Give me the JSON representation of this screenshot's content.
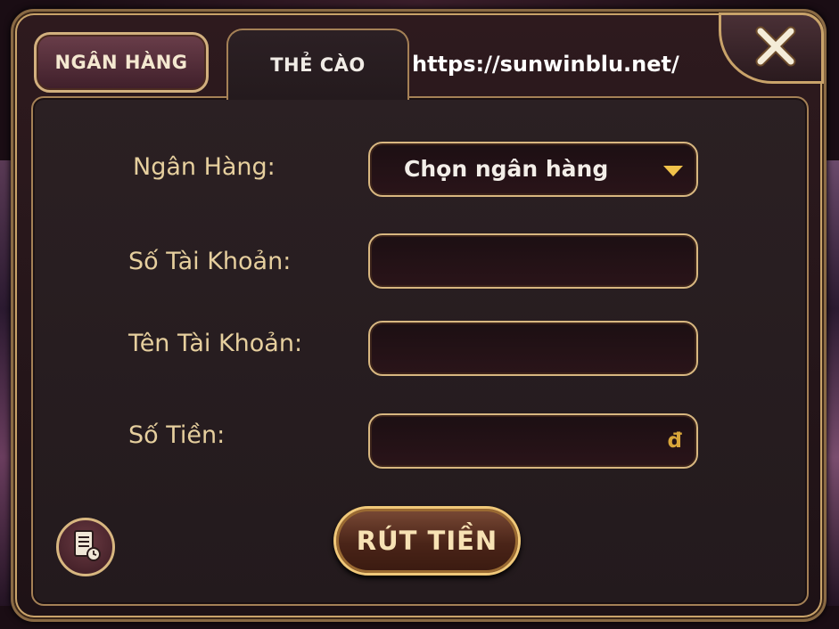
{
  "tabs": [
    {
      "label": "NGÂN HÀNG"
    },
    {
      "label": "THẺ CÀO"
    }
  ],
  "watermark_url": "https://sunwinblu.net/",
  "form": {
    "bank_label": "Ngân Hàng:",
    "bank_select_value": "Chọn ngân hàng",
    "account_number_label": "Số Tài Khoản:",
    "account_number_value": "",
    "account_name_label": "Tên Tài Khoản:",
    "account_name_value": "",
    "amount_label": "Số Tiền:",
    "amount_value": "",
    "currency_symbol": "đ"
  },
  "withdraw_button_label": "RÚT TIỀN",
  "icons": {
    "close": "close-icon",
    "dropdown": "caret-down-icon",
    "history": "history-icon"
  },
  "colors": {
    "gold_border": "#d8b780",
    "label_text": "#e6cf9e",
    "panel_bg": "#2b2023",
    "currency": "#d9a63a"
  }
}
